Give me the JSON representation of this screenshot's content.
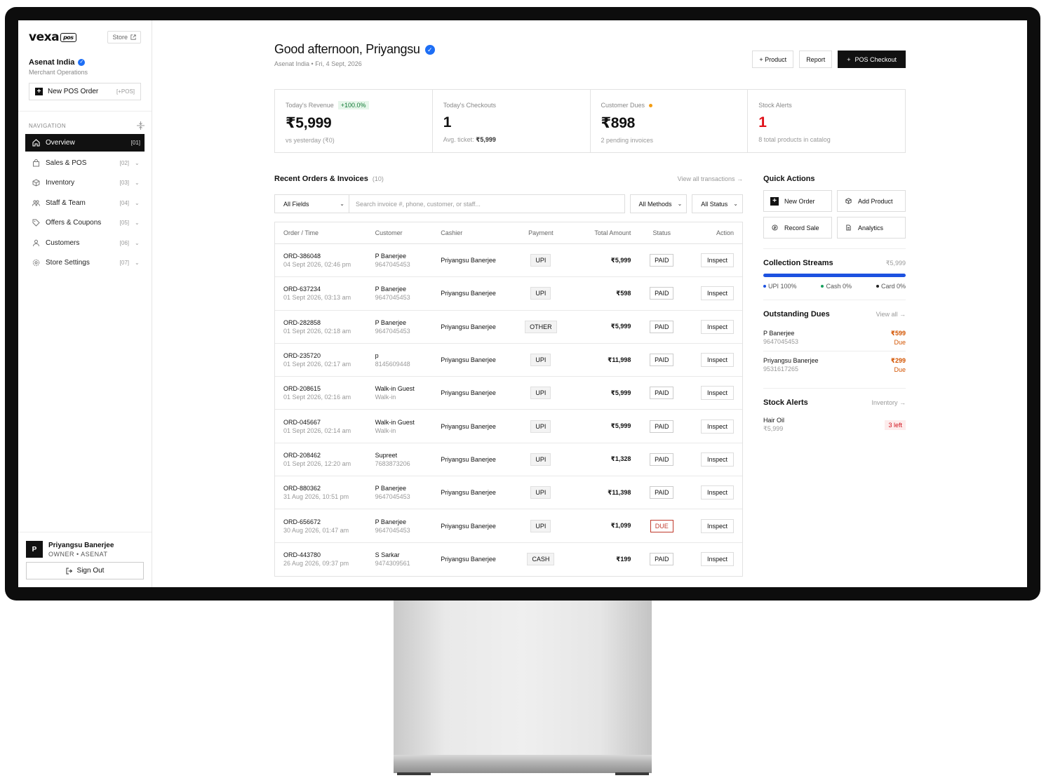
{
  "sidebar": {
    "logo": "vexa",
    "logo_tag": "pos",
    "store_label": "Store",
    "org_name": "Asenat India",
    "org_sub": "Merchant Operations",
    "new_pos_label": "New POS Order",
    "new_pos_kbd": "[+POS]",
    "nav_header": "NAVIGATION",
    "items": [
      {
        "label": "Overview",
        "num": "[01]"
      },
      {
        "label": "Sales & POS",
        "num": "[02]"
      },
      {
        "label": "Inventory",
        "num": "[03]"
      },
      {
        "label": "Staff & Team",
        "num": "[04]"
      },
      {
        "label": "Offers & Coupons",
        "num": "[05]"
      },
      {
        "label": "Customers",
        "num": "[06]"
      },
      {
        "label": "Store Settings",
        "num": "[07]"
      }
    ],
    "user_initial": "P",
    "user_name": "Priyangsu Banerjee",
    "user_role": "OWNER • ASENAT",
    "signout_label": "Sign Out"
  },
  "header": {
    "greeting": "Good afternoon, Priyangsu",
    "sub": "Asenat India • Fri, 4 Sept, 2026",
    "btn_product": "+ Product",
    "btn_report": "Report",
    "btn_checkout": "POS Checkout"
  },
  "stats": {
    "revenue": {
      "label": "Today's Revenue",
      "badge": "+100.0%",
      "value": "₹5,999",
      "note": "vs yesterday (₹0)"
    },
    "checkouts": {
      "label": "Today's Checkouts",
      "value": "1",
      "note_prefix": "Avg. ticket:",
      "note_value": "₹5,999"
    },
    "dues": {
      "label": "Customer Dues",
      "value": "₹898",
      "note": "2 pending invoices"
    },
    "stock": {
      "label": "Stock Alerts",
      "value": "1",
      "note": "8 total products in catalog"
    }
  },
  "orders": {
    "title": "Recent Orders & Invoices",
    "count": "(10)",
    "view_all": "View all transactions →",
    "field_select": "All Fields",
    "search_placeholder": "Search invoice #, phone, customer, or staff...",
    "methods_select": "All Methods",
    "status_select": "All Status",
    "columns": [
      "Order / Time",
      "Customer",
      "Cashier",
      "Payment",
      "Total Amount",
      "Status",
      "Action"
    ],
    "rows": [
      {
        "id": "ORD-386048",
        "time": "04 Sept 2026, 02:46 pm",
        "customer": "P Banerjee",
        "phone": "9647045453",
        "cashier": "Priyangsu Banerjee",
        "payment": "UPI",
        "amount": "₹5,999",
        "status": "PAID",
        "action": "Inspect"
      },
      {
        "id": "ORD-637234",
        "time": "01 Sept 2026, 03:13 am",
        "customer": "P Banerjee",
        "phone": "9647045453",
        "cashier": "Priyangsu Banerjee",
        "payment": "UPI",
        "amount": "₹598",
        "status": "PAID",
        "action": "Inspect"
      },
      {
        "id": "ORD-282858",
        "time": "01 Sept 2026, 02:18 am",
        "customer": "P Banerjee",
        "phone": "9647045453",
        "cashier": "Priyangsu Banerjee",
        "payment": "OTHER",
        "amount": "₹5,999",
        "status": "PAID",
        "action": "Inspect"
      },
      {
        "id": "ORD-235720",
        "time": "01 Sept 2026, 02:17 am",
        "customer": "p",
        "phone": "8145609448",
        "cashier": "Priyangsu Banerjee",
        "payment": "UPI",
        "amount": "₹11,998",
        "status": "PAID",
        "action": "Inspect"
      },
      {
        "id": "ORD-208615",
        "time": "01 Sept 2026, 02:16 am",
        "customer": "Walk-in Guest",
        "phone": "Walk-in",
        "cashier": "Priyangsu Banerjee",
        "payment": "UPI",
        "amount": "₹5,999",
        "status": "PAID",
        "action": "Inspect"
      },
      {
        "id": "ORD-045667",
        "time": "01 Sept 2026, 02:14 am",
        "customer": "Walk-in Guest",
        "phone": "Walk-in",
        "cashier": "Priyangsu Banerjee",
        "payment": "UPI",
        "amount": "₹5,999",
        "status": "PAID",
        "action": "Inspect"
      },
      {
        "id": "ORD-208462",
        "time": "01 Sept 2026, 12:20 am",
        "customer": "Supreet",
        "phone": "7683873206",
        "cashier": "Priyangsu Banerjee",
        "payment": "UPI",
        "amount": "₹1,328",
        "status": "PAID",
        "action": "Inspect"
      },
      {
        "id": "ORD-880362",
        "time": "31 Aug 2026, 10:51 pm",
        "customer": "P Banerjee",
        "phone": "9647045453",
        "cashier": "Priyangsu Banerjee",
        "payment": "UPI",
        "amount": "₹11,398",
        "status": "PAID",
        "action": "Inspect"
      },
      {
        "id": "ORD-656672",
        "time": "30 Aug 2026, 01:47 am",
        "customer": "P Banerjee",
        "phone": "9647045453",
        "cashier": "Priyangsu Banerjee",
        "payment": "UPI",
        "amount": "₹1,099",
        "status": "DUE",
        "action": "Inspect"
      },
      {
        "id": "ORD-443780",
        "time": "26 Aug 2026, 09:37 pm",
        "customer": "S Sarkar",
        "phone": "9474309561",
        "cashier": "Priyangsu Banerjee",
        "payment": "CASH",
        "amount": "₹199",
        "status": "PAID",
        "action": "Inspect"
      }
    ]
  },
  "quick_actions": {
    "title": "Quick Actions",
    "new_order": "New Order",
    "add_product": "Add Product",
    "record_sale": "Record Sale",
    "analytics": "Analytics"
  },
  "collection": {
    "title": "Collection Streams",
    "total": "₹5,999",
    "upi": "UPI 100%",
    "upi_share": 100,
    "cash": "Cash 0%",
    "card": "Card 0%",
    "colors": {
      "upi": "#1d52e0",
      "cash": "#17a05d",
      "card": "#222222"
    }
  },
  "dues": {
    "title": "Outstanding Dues",
    "view_all": "View all →",
    "rows": [
      {
        "name": "P Banerjee",
        "phone": "9647045453",
        "amount": "₹599",
        "label": "Due"
      },
      {
        "name": "Priyangsu Banerjee",
        "phone": "9531617265",
        "amount": "₹299",
        "label": "Due"
      }
    ]
  },
  "stock_alerts": {
    "title": "Stock Alerts",
    "link": "Inventory →",
    "item_name": "Hair Oil",
    "item_price": "₹5,999",
    "badge": "3 left"
  }
}
